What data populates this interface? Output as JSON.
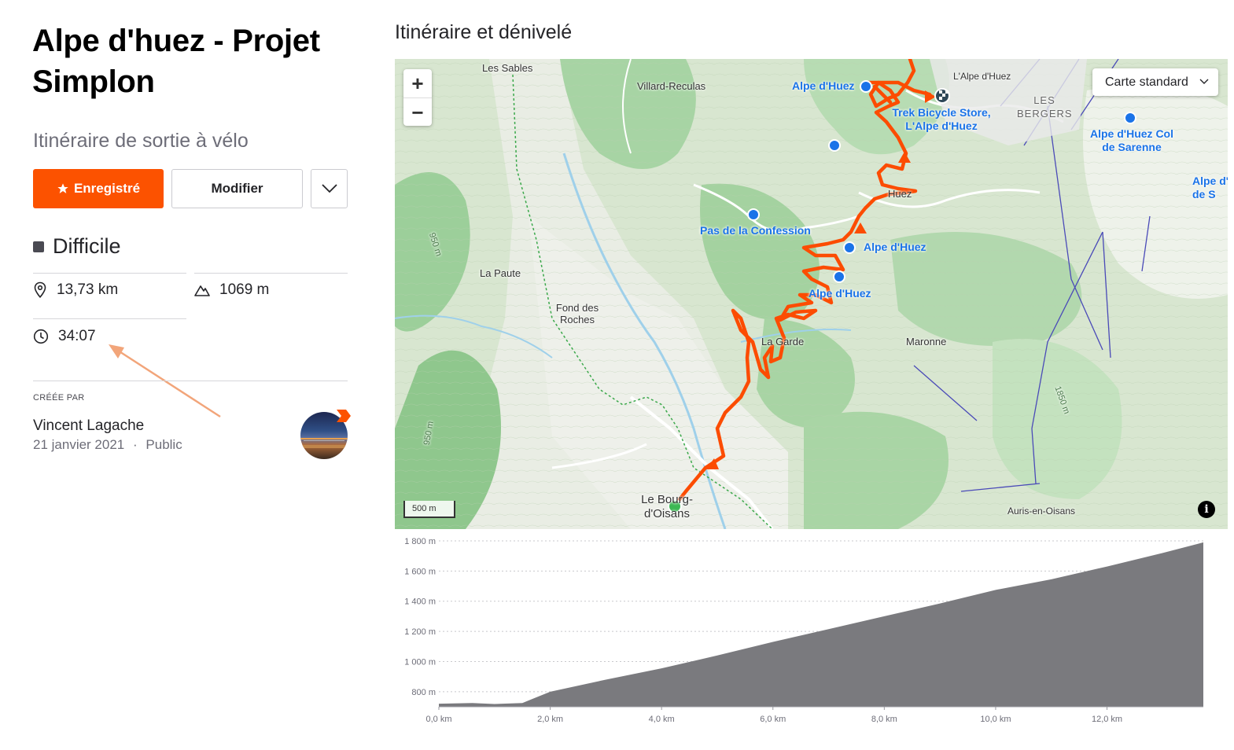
{
  "route": {
    "title": "Alpe d'huez - Projet Simplon",
    "subtitle": "Itinéraire de sortie à vélo",
    "saved_label": "Enregistré",
    "edit_label": "Modifier",
    "difficulty": "Difficile",
    "distance": "13,73 km",
    "elevation_gain": "1069 m",
    "duration": "34:07",
    "created_by_label": "CRÉÉE PAR",
    "author": "Vincent Lagache",
    "date": "21 janvier 2021",
    "visibility": "Public",
    "meta_separator": "·"
  },
  "section_title": "Itinéraire et dénivelé",
  "map": {
    "zoom_in": "+",
    "zoom_out": "−",
    "map_type": "Carte standard",
    "scale_label": "500 m",
    "info": "i",
    "place_labels": {
      "les_sables": "Les Sables",
      "villard_reculas": "Villard-Reculas",
      "alpe_dhuez_town": "L'Alpe d'Huez",
      "les_bergers": "LES BERGERS",
      "huez": "Huez",
      "la_paute": "La Paute",
      "fond_des_roches": "Fond des Roches",
      "la_garde": "La Garde",
      "maronne": "Maronne",
      "le_bourg": "Le Bourg-d'Oisans",
      "auris": "Auris-en-Oisans",
      "contour_950a": "950 m",
      "contour_950b": "950 m",
      "contour_1850": "1850 m"
    },
    "poi_labels": {
      "alpe1": "Alpe d'Huez",
      "trek": "Trek Bicycle Store, L'Alpe d'Huez",
      "col_sarenne": "Alpe d'Huez Col de Sarenne",
      "pas_confession": "Pas de la Confession",
      "alpe2": "Alpe d'Huez",
      "alpe3": "Alpe d'Huez",
      "edge": "Alpe d' de S"
    },
    "route_color": "#fc4c02",
    "start_color": "#3cb853"
  },
  "chart_data": {
    "type": "area",
    "title": "",
    "xlabel": "",
    "ylabel": "",
    "x_ticks": [
      "0,0 km",
      "2,0 km",
      "4,0 km",
      "6,0 km",
      "8,0 km",
      "10,0 km",
      "12,0 km"
    ],
    "y_ticks": [
      "800 m",
      "1 000 m",
      "1 200 m",
      "1 400 m",
      "1 600 m",
      "1 800 m"
    ],
    "xlim": [
      0,
      13.73
    ],
    "ylim": [
      700,
      1800
    ],
    "series": [
      {
        "x": [
          0,
          0.6,
          1.0,
          1.5,
          2.0,
          3.0,
          4.0,
          5.0,
          6.0,
          7.0,
          8.0,
          9.0,
          10.0,
          11.0,
          12.0,
          13.0,
          13.73
        ],
        "values": [
          720,
          725,
          718,
          725,
          800,
          880,
          955,
          1040,
          1130,
          1215,
          1300,
          1385,
          1475,
          1545,
          1630,
          1720,
          1790
        ]
      }
    ],
    "fill_color": "#7a7a7e",
    "grid": true
  }
}
